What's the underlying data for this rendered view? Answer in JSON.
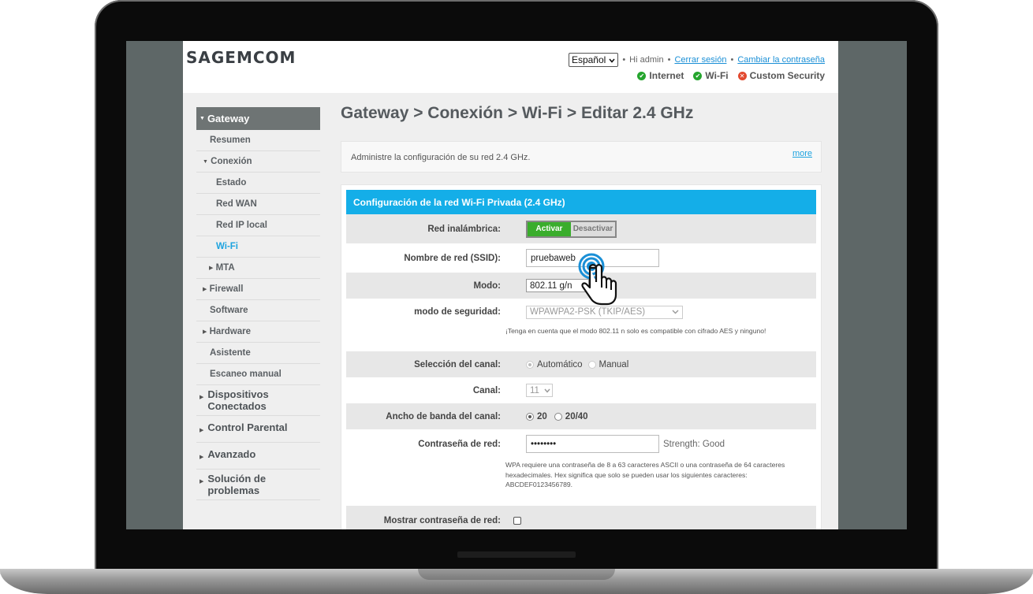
{
  "brand": {
    "logo_text": "Sagemcom"
  },
  "header": {
    "language": "Español",
    "greeting": "Hi admin",
    "logout_link": "Cerrar sesión",
    "change_password_link": "Cambiar la contraseña",
    "status": [
      {
        "label": "Internet",
        "state": "ok",
        "icon": "check-icon"
      },
      {
        "label": "Wi-Fi",
        "state": "ok",
        "icon": "check-icon"
      },
      {
        "label": "Custom Security",
        "state": "error",
        "icon": "x-icon"
      }
    ]
  },
  "sidebar": {
    "gateway": "Gateway",
    "items": {
      "resumen": "Resumen",
      "conexion": "Conexión",
      "estado": "Estado",
      "red_wan": "Red WAN",
      "red_ip_local": "Red IP local",
      "wifi": "Wi-Fi",
      "mta": "MTA",
      "firewall": "Firewall",
      "software": "Software",
      "hardware": "Hardware",
      "asistente": "Asistente",
      "escaneo": "Escaneo manual"
    },
    "sections": {
      "dispositivos_l1": "Dispositivos",
      "dispositivos_l2": "Conectados",
      "control_parental": "Control Parental",
      "avanzado": "Avanzado",
      "solucion_l1": "Solución de",
      "solucion_l2": "problemas"
    }
  },
  "main": {
    "title": "Gateway > Conexión > Wi-Fi > Editar 2.4 GHz",
    "info_text": "Administre la configuración de su red 2.4 GHz.",
    "more_link": "more",
    "panel_title": "Configuración de la red Wi-Fi Privada (2.4 GHz)",
    "form": {
      "wireless_label": "Red inalámbrica:",
      "enable_label": "Activar",
      "disable_label": "Desactivar",
      "ssid_label": "Nombre de red (SSID):",
      "ssid_value": "pruebaweb",
      "mode_label": "Modo:",
      "mode_value": "802.11 g/n",
      "security_label": "modo de seguridad:",
      "security_value": "WPAWPA2-PSK (TKIP/AES)",
      "security_note": "¡Tenga en cuenta que el modo 802.11 n solo es compatible con cifrado AES y ninguno!",
      "channel_sel_label": "Selección del canal:",
      "channel_auto": "Automático",
      "channel_manual": "Manual",
      "channel_label": "Canal:",
      "channel_value": "11",
      "bandwidth_label": "Ancho de banda del canal:",
      "bw_20": "20",
      "bw_2040": "20/40",
      "password_label": "Contraseña de red:",
      "password_value": "••••••••",
      "strength": "Strength: Good",
      "password_note_1": "WPA requiere una contraseña de 8 a 63 caracteres ASCII o una contraseña de 64 caracteres",
      "password_note_2": "hexadecimales. Hex significa que solo se pueden usar los siguientes caracteres:",
      "password_note_3": "ABCDEF0123456789.",
      "show_password_label": "Mostrar contraseña de red:"
    }
  }
}
